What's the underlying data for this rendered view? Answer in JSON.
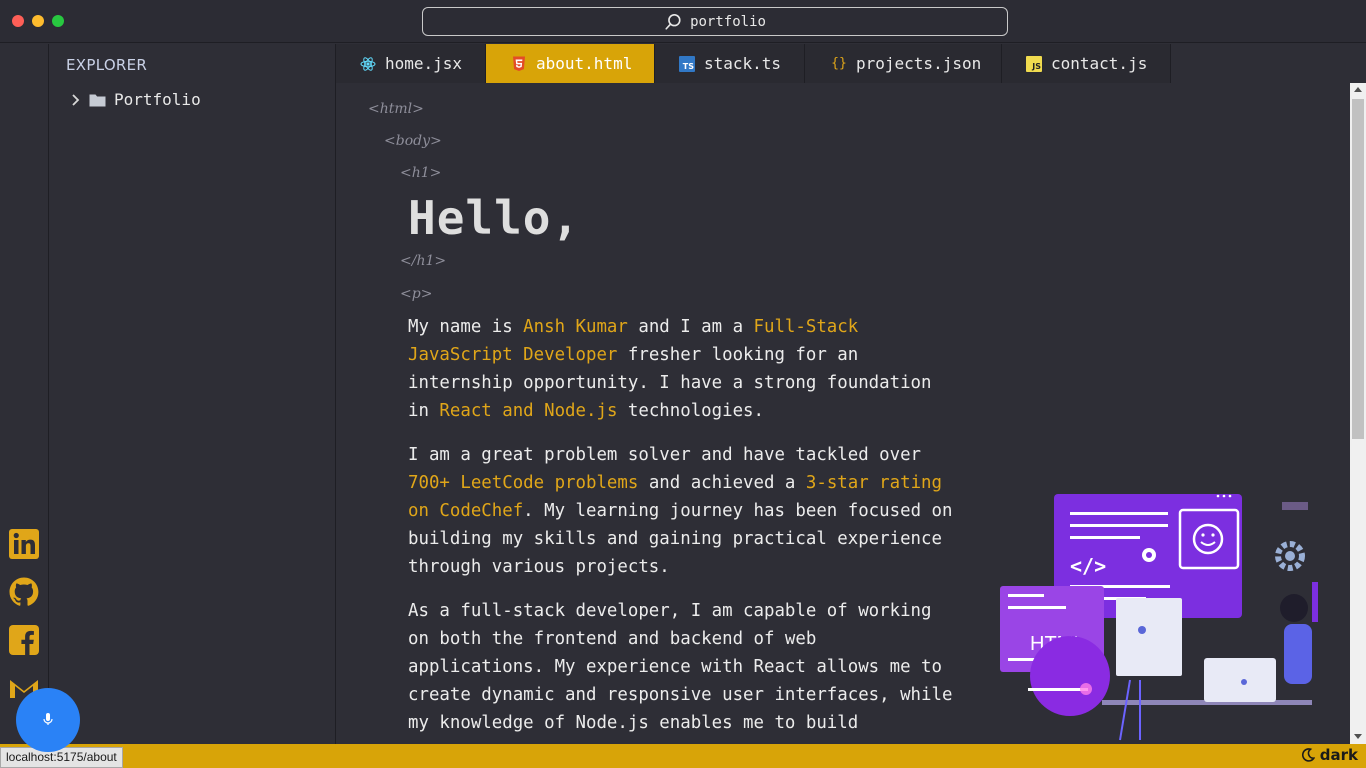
{
  "window": {
    "search_text": "portfolio",
    "search_icon": "search-icon"
  },
  "explorer": {
    "title": "EXPLORER",
    "items": [
      {
        "label": "Portfolio",
        "icon": "folder-icon",
        "expanded": false
      }
    ]
  },
  "social_links": [
    {
      "name": "linkedin",
      "icon": "linkedin-icon"
    },
    {
      "name": "github",
      "icon": "github-icon"
    },
    {
      "name": "facebook",
      "icon": "facebook-icon"
    },
    {
      "name": "gmail",
      "icon": "gmail-icon"
    }
  ],
  "tabs": [
    {
      "label": "home.jsx",
      "icon": "react-icon",
      "active": false
    },
    {
      "label": "about.html",
      "icon": "html5-icon",
      "active": true
    },
    {
      "label": "stack.ts",
      "icon": "typescript-icon",
      "active": false
    },
    {
      "label": "projects.json",
      "icon": "json-icon",
      "active": false
    },
    {
      "label": "contact.js",
      "icon": "javascript-icon",
      "active": false
    }
  ],
  "editor": {
    "tags": {
      "html_open": "<html>",
      "body_open": "<body>",
      "h1_open": "<h1>",
      "h1_close": "</h1>",
      "p_open": "<p>"
    },
    "heading": "Hello,",
    "p1": {
      "t1": "My name is ",
      "h1": "Ansh Kumar",
      "t2": " and I am a ",
      "h2": "Full-Stack JavaScript Developer",
      "t3": " fresher looking for an internship opportunity. I have a strong foundation in ",
      "h3": "React and Node.js",
      "t4": " technologies."
    },
    "p2": {
      "t1": "I am a great problem solver and have tackled over ",
      "h1": "700+ LeetCode problems",
      "t2": " and achieved a ",
      "h2": "3-star rating on CodeChef",
      "t3": ". My learning journey has been focused on building my skills and gaining practical experience through various projects."
    },
    "p3": "As a full-stack developer, I am capable of working on both the frontend and backend of web applications. My experience with React allows me to create dynamic and responsive user interfaces, while my knowledge of Node.js enables me to build"
  },
  "illustration": {
    "html_label": "HTML"
  },
  "status": {
    "url": "localhost:5175/about",
    "theme_label": "dark",
    "theme_icon": "moon-icon"
  },
  "mic": {
    "icon": "microphone-icon"
  },
  "colors": {
    "accent": "#d8a408",
    "highlight_text": "#e0a619",
    "background": "#2e2e36",
    "mic_button": "#2a82f6"
  }
}
